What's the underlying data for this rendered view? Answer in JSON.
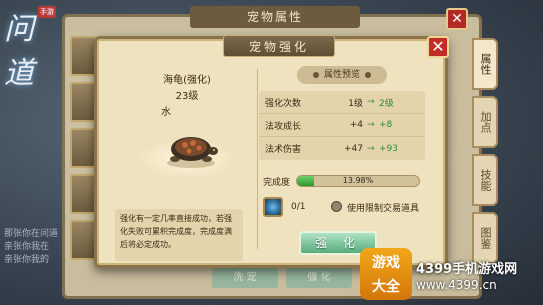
{
  "background": {
    "logo_text": "问道",
    "logo_badge": "手游",
    "window_title": "宠物属性",
    "close_label": "✕",
    "side_tabs": [
      "属性",
      "加点",
      "技能",
      "图鉴"
    ],
    "chat_lines": [
      "那张你在问道",
      "亲张你我在",
      "亲张你我的"
    ],
    "bottom_buttons": [
      "洗 宠",
      "强 化"
    ]
  },
  "dialog": {
    "title": "宠物强化",
    "close_label": "✕",
    "pet": {
      "name": "海龟(强化)",
      "level": "23级",
      "element": "水"
    },
    "preview": {
      "label": "属性预览",
      "rows": [
        {
          "name": "强化次数",
          "from": "1级",
          "to": "2级"
        },
        {
          "name": "法攻成长",
          "from": "+4",
          "to": "+8"
        },
        {
          "name": "法术伤害",
          "from": "+47",
          "to": "+93"
        }
      ],
      "arrow": "→"
    },
    "progress": {
      "label": "完成度",
      "percent_text": "13.98%",
      "value": 0.1398
    },
    "item": {
      "count": "0/1",
      "bind_label": "使用限制交易道具"
    },
    "description": "强化有一定几率直接成功，若强化失败可累积完成度，完成度满后将必定成功。",
    "enhance_button": "强 化"
  },
  "watermark": {
    "logo_line1": "游戏",
    "logo_line2": "大全",
    "text": "4399手机游戏网",
    "url": "www.4399.cn"
  }
}
